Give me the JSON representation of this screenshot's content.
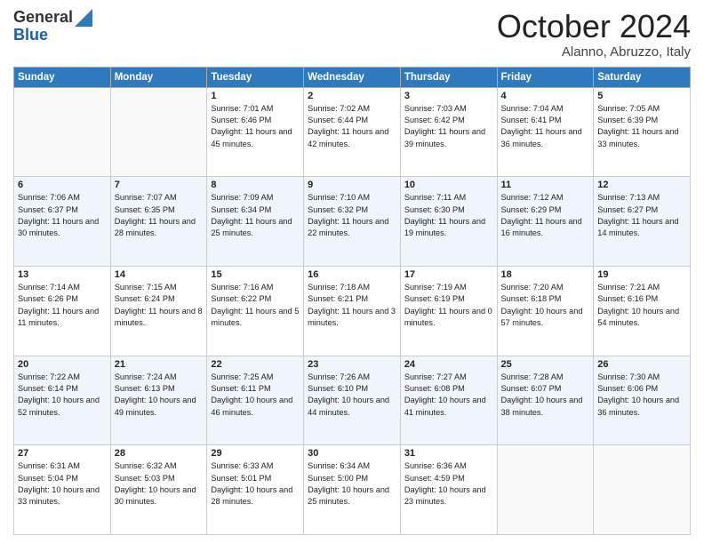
{
  "header": {
    "logo_general": "General",
    "logo_blue": "Blue",
    "month_title": "October 2024",
    "location": "Alanno, Abruzzo, Italy"
  },
  "days_of_week": [
    "Sunday",
    "Monday",
    "Tuesday",
    "Wednesday",
    "Thursday",
    "Friday",
    "Saturday"
  ],
  "weeks": [
    [
      {
        "day": "",
        "info": ""
      },
      {
        "day": "",
        "info": ""
      },
      {
        "day": "1",
        "info": "Sunrise: 7:01 AM\nSunset: 6:46 PM\nDaylight: 11 hours and 45 minutes."
      },
      {
        "day": "2",
        "info": "Sunrise: 7:02 AM\nSunset: 6:44 PM\nDaylight: 11 hours and 42 minutes."
      },
      {
        "day": "3",
        "info": "Sunrise: 7:03 AM\nSunset: 6:42 PM\nDaylight: 11 hours and 39 minutes."
      },
      {
        "day": "4",
        "info": "Sunrise: 7:04 AM\nSunset: 6:41 PM\nDaylight: 11 hours and 36 minutes."
      },
      {
        "day": "5",
        "info": "Sunrise: 7:05 AM\nSunset: 6:39 PM\nDaylight: 11 hours and 33 minutes."
      }
    ],
    [
      {
        "day": "6",
        "info": "Sunrise: 7:06 AM\nSunset: 6:37 PM\nDaylight: 11 hours and 30 minutes."
      },
      {
        "day": "7",
        "info": "Sunrise: 7:07 AM\nSunset: 6:35 PM\nDaylight: 11 hours and 28 minutes."
      },
      {
        "day": "8",
        "info": "Sunrise: 7:09 AM\nSunset: 6:34 PM\nDaylight: 11 hours and 25 minutes."
      },
      {
        "day": "9",
        "info": "Sunrise: 7:10 AM\nSunset: 6:32 PM\nDaylight: 11 hours and 22 minutes."
      },
      {
        "day": "10",
        "info": "Sunrise: 7:11 AM\nSunset: 6:30 PM\nDaylight: 11 hours and 19 minutes."
      },
      {
        "day": "11",
        "info": "Sunrise: 7:12 AM\nSunset: 6:29 PM\nDaylight: 11 hours and 16 minutes."
      },
      {
        "day": "12",
        "info": "Sunrise: 7:13 AM\nSunset: 6:27 PM\nDaylight: 11 hours and 14 minutes."
      }
    ],
    [
      {
        "day": "13",
        "info": "Sunrise: 7:14 AM\nSunset: 6:26 PM\nDaylight: 11 hours and 11 minutes."
      },
      {
        "day": "14",
        "info": "Sunrise: 7:15 AM\nSunset: 6:24 PM\nDaylight: 11 hours and 8 minutes."
      },
      {
        "day": "15",
        "info": "Sunrise: 7:16 AM\nSunset: 6:22 PM\nDaylight: 11 hours and 5 minutes."
      },
      {
        "day": "16",
        "info": "Sunrise: 7:18 AM\nSunset: 6:21 PM\nDaylight: 11 hours and 3 minutes."
      },
      {
        "day": "17",
        "info": "Sunrise: 7:19 AM\nSunset: 6:19 PM\nDaylight: 11 hours and 0 minutes."
      },
      {
        "day": "18",
        "info": "Sunrise: 7:20 AM\nSunset: 6:18 PM\nDaylight: 10 hours and 57 minutes."
      },
      {
        "day": "19",
        "info": "Sunrise: 7:21 AM\nSunset: 6:16 PM\nDaylight: 10 hours and 54 minutes."
      }
    ],
    [
      {
        "day": "20",
        "info": "Sunrise: 7:22 AM\nSunset: 6:14 PM\nDaylight: 10 hours and 52 minutes."
      },
      {
        "day": "21",
        "info": "Sunrise: 7:24 AM\nSunset: 6:13 PM\nDaylight: 10 hours and 49 minutes."
      },
      {
        "day": "22",
        "info": "Sunrise: 7:25 AM\nSunset: 6:11 PM\nDaylight: 10 hours and 46 minutes."
      },
      {
        "day": "23",
        "info": "Sunrise: 7:26 AM\nSunset: 6:10 PM\nDaylight: 10 hours and 44 minutes."
      },
      {
        "day": "24",
        "info": "Sunrise: 7:27 AM\nSunset: 6:08 PM\nDaylight: 10 hours and 41 minutes."
      },
      {
        "day": "25",
        "info": "Sunrise: 7:28 AM\nSunset: 6:07 PM\nDaylight: 10 hours and 38 minutes."
      },
      {
        "day": "26",
        "info": "Sunrise: 7:30 AM\nSunset: 6:06 PM\nDaylight: 10 hours and 36 minutes."
      }
    ],
    [
      {
        "day": "27",
        "info": "Sunrise: 6:31 AM\nSunset: 5:04 PM\nDaylight: 10 hours and 33 minutes."
      },
      {
        "day": "28",
        "info": "Sunrise: 6:32 AM\nSunset: 5:03 PM\nDaylight: 10 hours and 30 minutes."
      },
      {
        "day": "29",
        "info": "Sunrise: 6:33 AM\nSunset: 5:01 PM\nDaylight: 10 hours and 28 minutes."
      },
      {
        "day": "30",
        "info": "Sunrise: 6:34 AM\nSunset: 5:00 PM\nDaylight: 10 hours and 25 minutes."
      },
      {
        "day": "31",
        "info": "Sunrise: 6:36 AM\nSunset: 4:59 PM\nDaylight: 10 hours and 23 minutes."
      },
      {
        "day": "",
        "info": ""
      },
      {
        "day": "",
        "info": ""
      }
    ]
  ]
}
